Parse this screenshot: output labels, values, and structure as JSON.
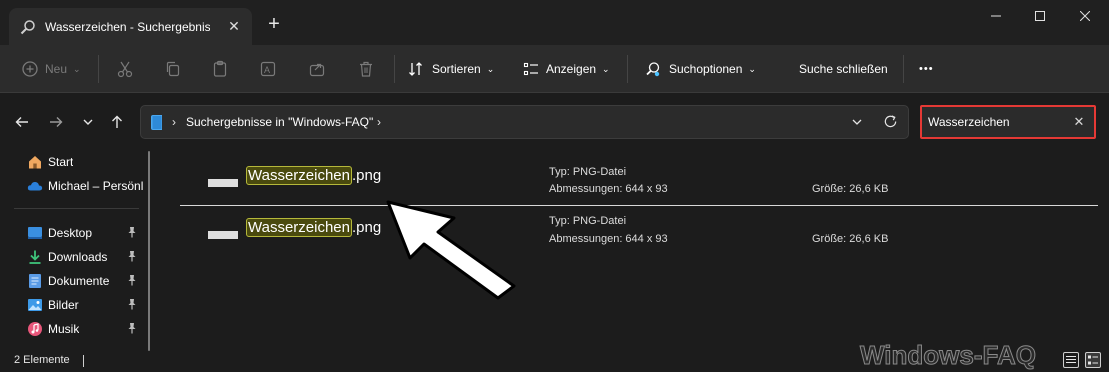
{
  "tab": {
    "title": "Wasserzeichen - Suchergebnisse in \"Windows-FAQ\"",
    "icon": "search-icon"
  },
  "window_controls": {
    "minimize": "—",
    "maximize": "☐",
    "close": "✕"
  },
  "toolbar": {
    "new_label": "Neu",
    "sort_label": "Sortieren",
    "view_label": "Anzeigen",
    "search_options_label": "Suchoptionen",
    "close_search_label": "Suche schließen",
    "more_label": "•••"
  },
  "address": {
    "crumb": "Suchergebnisse in \"Windows-FAQ\""
  },
  "search": {
    "value": "Wasserzeichen"
  },
  "sidebar": {
    "items": [
      {
        "label": "Start",
        "icon": "home-icon"
      },
      {
        "label": "Michael – Persönl",
        "icon": "onedrive-icon"
      },
      {
        "label": "Desktop",
        "icon": "desktop-icon"
      },
      {
        "label": "Downloads",
        "icon": "downloads-icon"
      },
      {
        "label": "Dokumente",
        "icon": "documents-icon"
      },
      {
        "label": "Bilder",
        "icon": "pictures-icon"
      },
      {
        "label": "Musik",
        "icon": "music-icon"
      }
    ]
  },
  "results": [
    {
      "name_highlight": "Wasserzeichen",
      "name_rest": ".png",
      "type": "Typ: PNG-Datei",
      "dimensions": "Abmessungen: 644 x 93",
      "size": "Größe: 26,6 KB"
    },
    {
      "name_highlight": "Wasserzeichen",
      "name_rest": ".png",
      "type": "Typ: PNG-Datei",
      "dimensions": "Abmessungen: 644 x 93",
      "size": "Größe: 26,6 KB"
    }
  ],
  "status": {
    "count": "2 Elemente"
  },
  "watermark": "Windows-FAQ",
  "colors": {
    "accent_search_border": "#e53935",
    "highlight_bg": "#4a4a0e",
    "highlight_border": "#b5b83a"
  }
}
